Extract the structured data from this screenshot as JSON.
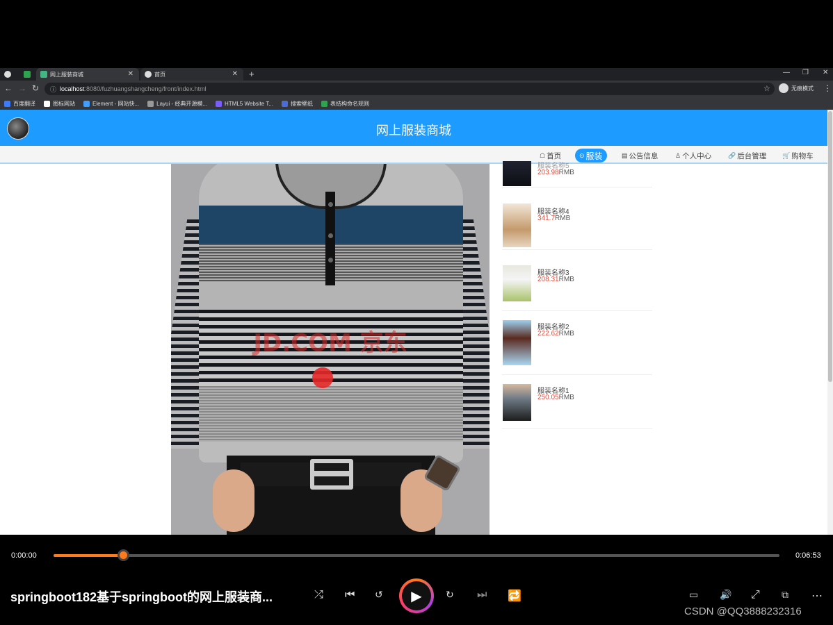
{
  "browser": {
    "tabs": [
      {
        "label": ""
      },
      {
        "label": ""
      },
      {
        "label": "网上服装商城"
      },
      {
        "label": "首页"
      }
    ],
    "new_tab": "+",
    "url_host": "localhost",
    "url_path": ":8080/fuzhuangshangcheng/front/index.html",
    "incognito_label": "无痕模式",
    "bookmarks": [
      "百度翻译",
      "图标网站",
      "Element - 网站快...",
      "Layui - 经典开源模...",
      "HTML5 Website T...",
      "搜索壁纸",
      "表结构命名规则"
    ]
  },
  "site": {
    "title": "网上服装商城",
    "nav": [
      {
        "icon": "☖",
        "label": "首页"
      },
      {
        "icon": "⊙",
        "label": "服装"
      },
      {
        "icon": "▤",
        "label": "公告信息"
      },
      {
        "icon": "♙",
        "label": "个人中心"
      },
      {
        "icon": "🔗",
        "label": "后台管理"
      },
      {
        "icon": "🛒",
        "label": "购物车"
      }
    ],
    "watermark": "JD.COM 京东",
    "products": [
      {
        "name": "服装名称5",
        "price": "203.98",
        "currency": "RMB"
      },
      {
        "name": "服装名称4",
        "price": "341.7",
        "currency": "RMB"
      },
      {
        "name": "服装名称3",
        "price": "208.31",
        "currency": "RMB"
      },
      {
        "name": "服装名称2",
        "price": "222.62",
        "currency": "RMB"
      },
      {
        "name": "服装名称1",
        "price": "250.05",
        "currency": "RMB"
      }
    ]
  },
  "player": {
    "current_time": "0:00:00",
    "total_time": "0:06:53",
    "progress_fraction": 0.096,
    "title": "springboot182基于springboot的网上服装商...",
    "watermark": "CSDN @QQ3888232316",
    "accent_color": "#ff7a1a"
  }
}
